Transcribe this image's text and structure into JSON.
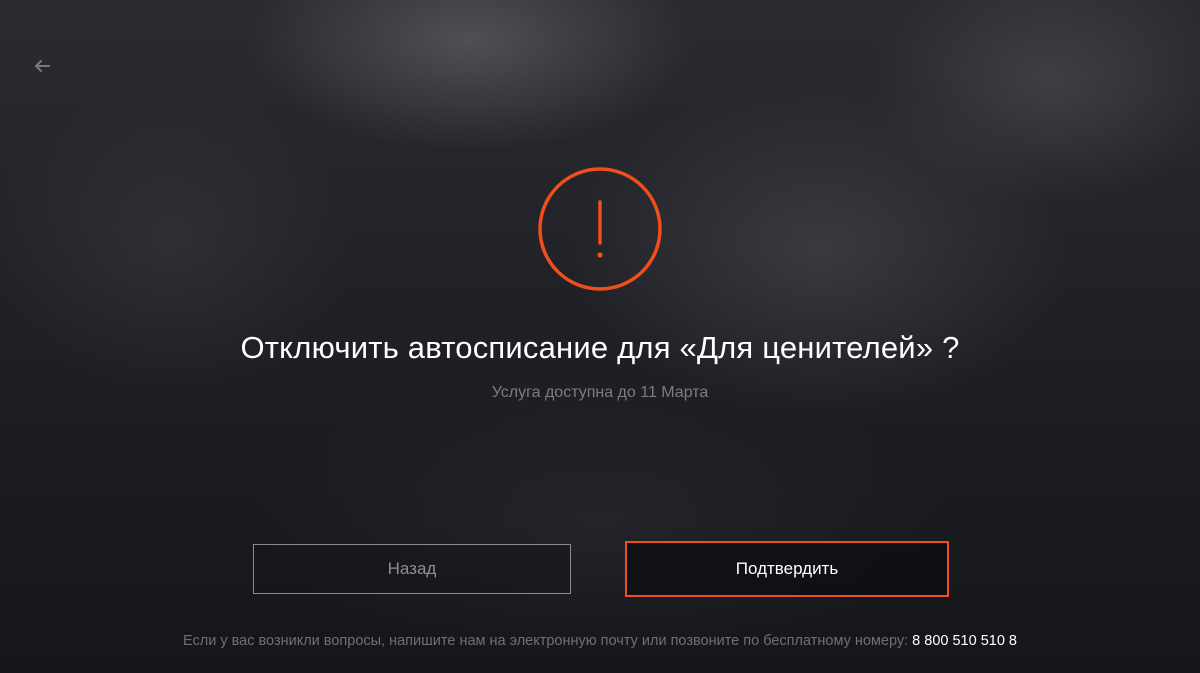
{
  "colors": {
    "accent": "#f04e1b",
    "text": "#ffffff",
    "muted": "#7c7d83",
    "background": "#1e1f24"
  },
  "icons": {
    "back": "arrow-left-icon",
    "alert": "exclamation-circle-icon"
  },
  "dialog": {
    "title": "Отключить автосписание для «Для ценителей» ?",
    "subtitle": "Услуга доступна до 11 Марта"
  },
  "buttons": {
    "back_label": "Назад",
    "confirm_label": "Подтвердить"
  },
  "footer": {
    "text": "Если у вас возникли вопросы, напишите нам на электронную почту или позвоните по бесплатному номеру:",
    "phone": "8 800 510 510 8"
  }
}
